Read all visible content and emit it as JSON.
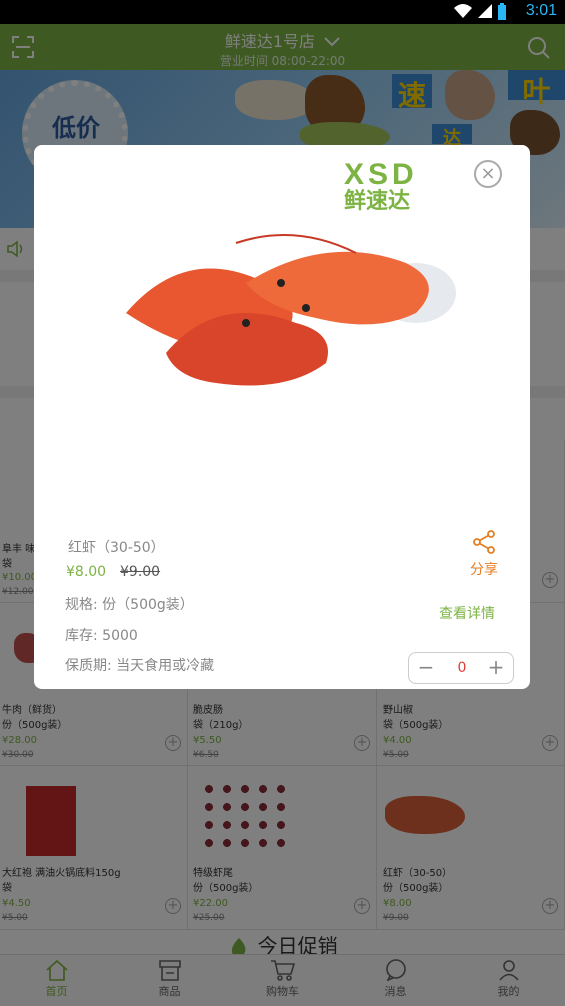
{
  "status_bar": {
    "time": "3:01"
  },
  "header": {
    "store_name": "鲜速达1号店",
    "hours": "营业时间 08:00-22:00"
  },
  "banner": {
    "tag": "低价",
    "tiles": [
      "速",
      "达",
      "叶"
    ]
  },
  "grid": {
    "row1": [
      {
        "name": "阜丰 味",
        "unit": "袋",
        "price": "¥10.00",
        "old": "¥12.00"
      },
      {
        "name": "",
        "unit": "",
        "price": "",
        "old": ""
      },
      {
        "name": "",
        "unit": "",
        "price": "",
        "old": ""
      }
    ],
    "row2": [
      {
        "name": "牛肉（鲜货）",
        "unit": "份（500g装）",
        "price": "¥28.00",
        "old": "¥30.00"
      },
      {
        "name": "脆皮肠",
        "unit": "袋（210g）",
        "price": "¥5.50",
        "old": "¥6.50"
      },
      {
        "name": "野山椒",
        "unit": "袋（500g装）",
        "price": "¥4.00",
        "old": "¥5.00"
      }
    ],
    "row3": [
      {
        "name": "大红袍 满油火锅底料150g",
        "unit": "袋",
        "price": "¥4.50",
        "old": "¥5.00"
      },
      {
        "name": "特级虾尾",
        "unit": "份（500g装）",
        "price": "¥22.00",
        "old": "¥25.00"
      },
      {
        "name": "红虾（30-50）",
        "unit": "份（500g装）",
        "price": "¥8.00",
        "old": "¥9.00"
      }
    ]
  },
  "promo": {
    "title": "今日促销"
  },
  "tabs": [
    {
      "label": "首页",
      "icon": "home-icon"
    },
    {
      "label": "商品",
      "icon": "store-icon"
    },
    {
      "label": "购物车",
      "icon": "cart-icon"
    },
    {
      "label": "消息",
      "icon": "message-icon"
    },
    {
      "label": "我的",
      "icon": "user-icon"
    }
  ],
  "modal": {
    "logo_text": "鲜速达",
    "logo_brand": "XSD",
    "product_name": "红虾（30-50）",
    "price": "¥8.00",
    "old_price": "¥9.00",
    "spec": "规格: 份（500g装）",
    "stock": "库存: 5000",
    "shelf_life": "保质期: 当天食用或冷藏",
    "share_label": "分享",
    "detail_label": "查看详情",
    "quantity": "0"
  },
  "colors": {
    "brand_green": "#7cb342",
    "accent_orange": "#e67e22",
    "qty_red": "#e53935"
  }
}
